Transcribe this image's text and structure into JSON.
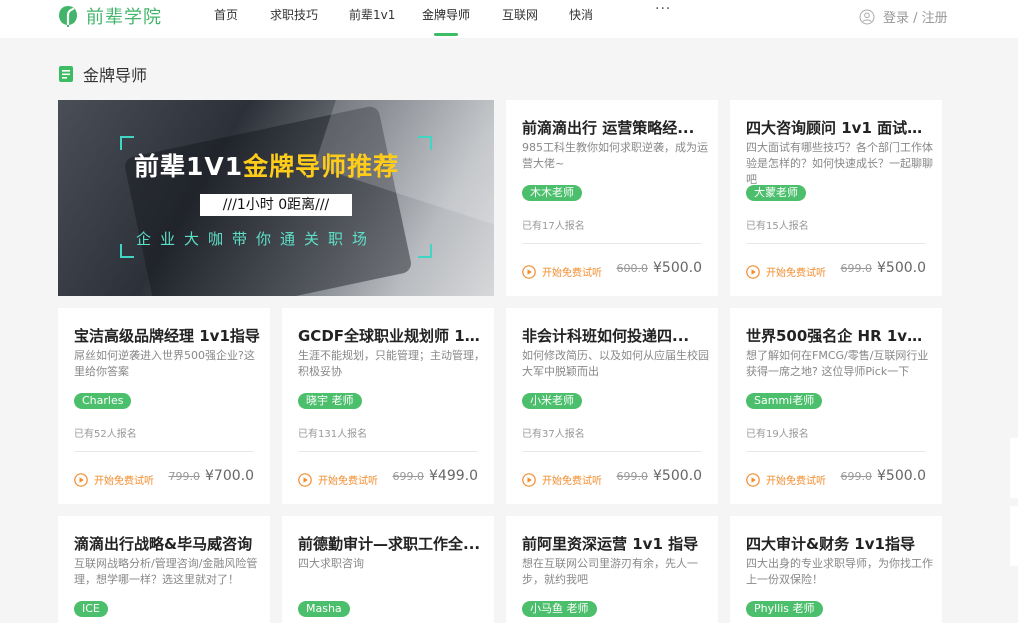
{
  "header": {
    "logo": "前辈学院",
    "nav": [
      "首页",
      "求职技巧",
      "前辈1v1",
      "金牌导师",
      "互联网",
      "快消"
    ],
    "more": "···",
    "login": "登录 / 注册",
    "accent": "#3dbd63"
  },
  "section": {
    "title": "金牌导师"
  },
  "banner": {
    "title_pre": "前辈1V1",
    "title_hl": "金牌导师推荐",
    "subtitle": "///1小时  0距离///",
    "tagline": "企业大咖带你通关职场"
  },
  "cards": [
    {
      "title": "前滴滴出行 运营策略经...",
      "desc": "985工科生教你如何求职逆袭，成为运营大佬~",
      "mentor": "木木老师",
      "count": "已有17人报名",
      "trial": "开始免费试听",
      "orig_price": "600.0",
      "price": "¥500.0"
    },
    {
      "title": "四大咨询顾问 1v1 面试辅...",
      "desc": "四大面试有哪些技巧？各个部门工作体验是怎样的？如何快速成长？一起聊聊吧",
      "mentor": "大蒙老师",
      "count": "已有15人报名",
      "trial": "开始免费试听",
      "orig_price": "699.0",
      "price": "¥500.0"
    },
    {
      "title": "宝洁高级品牌经理 1v1指导",
      "desc": "屌丝如何逆袭进入世界500强企业?这里给你答案",
      "mentor": "Charles",
      "count": "已有52人报名",
      "trial": "开始免费试听",
      "orig_price": "799.0",
      "price": "¥700.0"
    },
    {
      "title": "GCDF全球职业规划师 1v...",
      "desc": "生涯不能规划，只能管理；主动管理，积极妥协",
      "mentor": "晓宇 老师",
      "count": "已有131人报名",
      "trial": "开始免费试听",
      "orig_price": "699.0",
      "price": "¥499.0"
    },
    {
      "title": "非会计科班如何投递四...",
      "desc": "如何修改简历、以及如何从应届生校园大军中脱颖而出",
      "mentor": "小米老师",
      "count": "已有37人报名",
      "trial": "开始免费试听",
      "orig_price": "699.0",
      "price": "¥500.0"
    },
    {
      "title": "世界500强名企 HR 1v1 ...",
      "desc": "想了解如何在FMCG/零售/互联网行业获得一席之地? 这位导师Pick一下",
      "mentor": "Sammi老师",
      "count": "已有19人报名",
      "trial": "开始免费试听",
      "orig_price": "699.0",
      "price": "¥500.0"
    },
    {
      "title": "滴滴出行战略&毕马威咨询",
      "desc": "互联网战略分析/管理咨询/金融风险管理，想学哪一样？选这里就对了！",
      "mentor": "ICE"
    },
    {
      "title": "前德勤审计—求职工作全...",
      "desc": "四大求职咨询",
      "mentor": "Masha"
    },
    {
      "title": "前阿里资深运营 1v1 指导",
      "desc": "想在互联网公司里游刃有余，先人一步，就约我吧",
      "mentor": "小马鱼 老师"
    },
    {
      "title": "四大审计&财务 1v1指导",
      "desc": "四大出身的专业求职导师，为你找工作上一份双保险！",
      "mentor": "Phyllis 老师"
    }
  ]
}
